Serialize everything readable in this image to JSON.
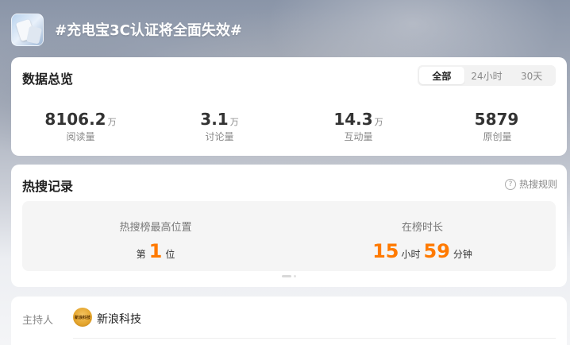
{
  "topic": {
    "title": "#充电宝3C认证将全面失效#"
  },
  "overview": {
    "title": "数据总览",
    "tabs": [
      {
        "label": "全部",
        "active": true
      },
      {
        "label": "24小时",
        "active": false
      },
      {
        "label": "30天",
        "active": false
      }
    ],
    "stats": [
      {
        "value": "8106.2",
        "unit": "万",
        "label": "阅读量"
      },
      {
        "value": "3.1",
        "unit": "万",
        "label": "讨论量"
      },
      {
        "value": "14.3",
        "unit": "万",
        "label": "互动量"
      },
      {
        "value": "5879",
        "unit": "",
        "label": "原创量"
      }
    ]
  },
  "hot_search": {
    "title": "热搜记录",
    "rules_label": "热搜规则",
    "rules_icon": "?",
    "highest_rank": {
      "label": "热搜榜最高位置",
      "prefix": "第",
      "value": "1",
      "suffix": "位"
    },
    "duration": {
      "label": "在榜时长",
      "hours": "15",
      "hours_unit": "小时",
      "minutes": "59",
      "minutes_unit": "分钟"
    }
  },
  "host": {
    "label": "主持人",
    "name": "新浪科技",
    "avatar_text": "新浪科技"
  },
  "colors": {
    "accent": "#ff7a00",
    "card_bg": "#ffffff",
    "panel_bg": "#f5f5f5"
  }
}
